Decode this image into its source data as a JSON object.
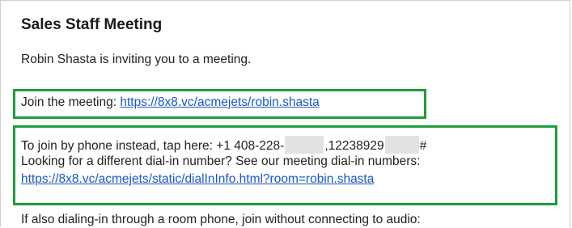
{
  "email": {
    "title": "Sales Staff Meeting",
    "invite_text": "Robin Shasta is inviting you to a meeting.",
    "join_label": "Join the meeting: ",
    "join_link": "https://8x8.vc/acmejets/robin.shasta",
    "phone_prefix": "To join by phone instead, tap here: +1 408-228-",
    "phone_mid": ",12238929",
    "phone_suffix": "#",
    "dialin_text": "Looking for a different dial-in number? See our meeting dial-in numbers:",
    "dialin_link": "https://8x8.vc/acmejets/static/dialInInfo.html?room=robin.shasta",
    "room_phone_text": "If also dialing-in through a room phone, join without connecting to audio:"
  },
  "colors": {
    "highlight_border": "#1e9e3a",
    "link": "#1a56c9",
    "redaction": "#e2e2e2"
  }
}
